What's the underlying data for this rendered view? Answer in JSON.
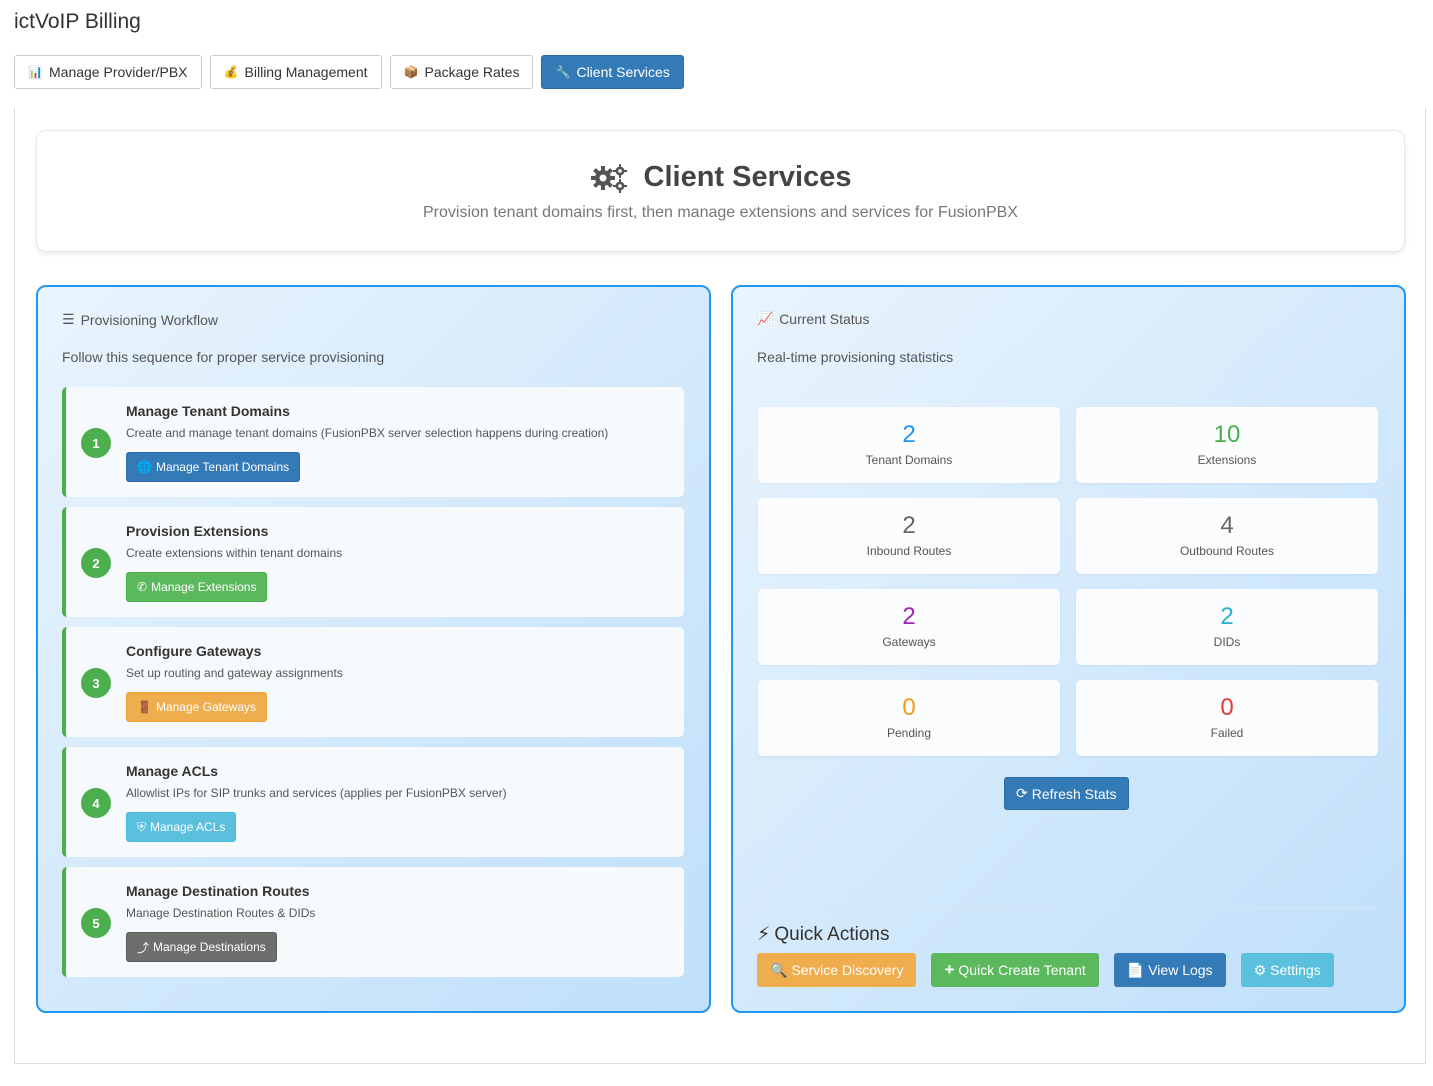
{
  "app_title": "ictVoIP Billing",
  "tabs": [
    {
      "label": "Manage Provider/PBX",
      "icon": "bar-chart-icon",
      "glyph": "📊",
      "active": false
    },
    {
      "label": "Billing Management",
      "icon": "money-bag-icon",
      "glyph": "💰",
      "active": false
    },
    {
      "label": "Package Rates",
      "icon": "package-icon",
      "glyph": "📦",
      "active": false
    },
    {
      "label": "Client Services",
      "icon": "wrench-icon",
      "glyph": "🔧",
      "active": true
    }
  ],
  "header": {
    "title": "Client Services",
    "subtitle": "Provision tenant domains first, then manage extensions and services for FusionPBX",
    "icon": "gears-icon"
  },
  "workflow": {
    "title": "Provisioning Workflow",
    "description": "Follow this sequence for proper service provisioning",
    "steps": [
      {
        "num": "1",
        "title": "Manage Tenant Domains",
        "desc": "Create and manage tenant domains (FusionPBX server selection happens during creation)",
        "button": "Manage Tenant Domains",
        "icon": "globe-icon",
        "glyph": "🌐",
        "color": "#337ab7"
      },
      {
        "num": "2",
        "title": "Provision Extensions",
        "desc": "Create extensions within tenant domains",
        "button": "Manage Extensions",
        "icon": "phone-icon",
        "glyph": "✆",
        "color": "#5cb85c"
      },
      {
        "num": "3",
        "title": "Configure Gateways",
        "desc": "Set up routing and gateway assignments",
        "button": "Manage Gateways",
        "icon": "door-icon",
        "glyph": "🚪",
        "color": "#f0ad4e"
      },
      {
        "num": "4",
        "title": "Manage ACLs",
        "desc": "Allowlist IPs for SIP trunks and services (applies per FusionPBX server)",
        "button": "Manage ACLs",
        "icon": "shield-icon",
        "glyph": "⛨",
        "color": "#5bc0de"
      },
      {
        "num": "5",
        "title": "Manage Destination Routes",
        "desc": "Manage Destination Routes & DIDs",
        "button": "Manage Destinations",
        "icon": "route-icon",
        "glyph": "⤴",
        "color": "#6c6f6c"
      }
    ]
  },
  "status": {
    "title": "Current Status",
    "description": "Real-time provisioning statistics",
    "stats": [
      {
        "value": "2",
        "label": "Tenant Domains",
        "color": "#2196f3"
      },
      {
        "value": "10",
        "label": "Extensions",
        "color": "#4cae4c"
      },
      {
        "value": "2",
        "label": "Inbound Routes",
        "color": "#666666"
      },
      {
        "value": "4",
        "label": "Outbound Routes",
        "color": "#666666"
      },
      {
        "value": "2",
        "label": "Gateways",
        "color": "#9c27b0"
      },
      {
        "value": "2",
        "label": "DIDs",
        "color": "#26b3c9"
      },
      {
        "value": "0",
        "label": "Pending",
        "color": "#f39c12"
      },
      {
        "value": "0",
        "label": "Failed",
        "color": "#e53935"
      }
    ],
    "refresh_label": "Refresh Stats"
  },
  "quick_actions": {
    "title": "Quick Actions",
    "buttons": [
      {
        "label": "Service Discovery",
        "icon": "search-icon",
        "glyph": "🔍",
        "color": "#f0ad4e"
      },
      {
        "label": "Quick Create Tenant",
        "icon": "plus-icon",
        "glyph": "+",
        "color": "#5cb85c"
      },
      {
        "label": "View Logs",
        "icon": "file-icon",
        "glyph": "📄",
        "color": "#337ab7"
      },
      {
        "label": "Settings",
        "icon": "gear-icon",
        "glyph": "⚙",
        "color": "#5bc0de"
      }
    ]
  }
}
